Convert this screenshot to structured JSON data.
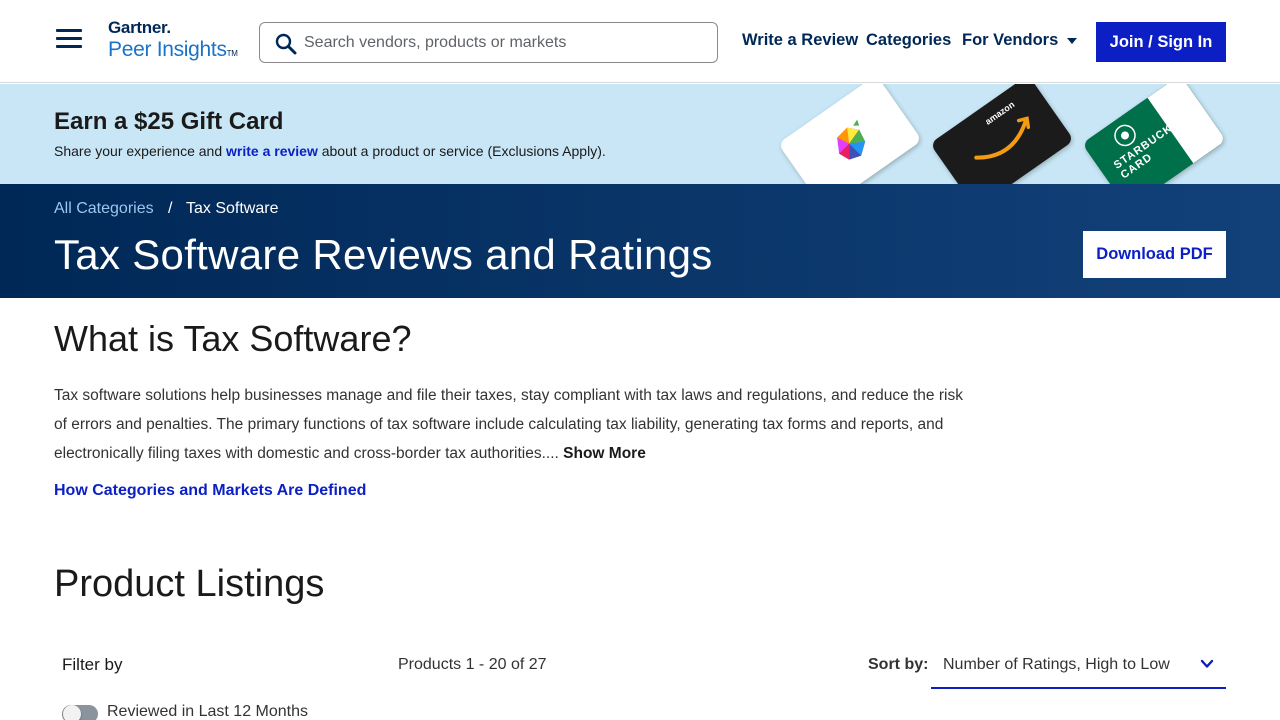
{
  "header": {
    "logo_top": "Gartner.",
    "logo_bottom": "Peer Insights",
    "logo_tm": "TM",
    "search_placeholder": "Search vendors, products or markets",
    "nav_write": "Write a Review",
    "nav_categories": "Categories",
    "nav_vendors": "For Vendors",
    "join_label": "Join / Sign In",
    "icons": [
      "menu-icon",
      "search-icon",
      "caret-down-icon"
    ]
  },
  "promo": {
    "title": "Earn a $25 Gift Card",
    "text_before": "Share your experience and ",
    "link": "write a review",
    "text_after": " about a product or service (Exclusions Apply).",
    "cards": [
      "apple",
      "amazon",
      "STARBUCKS CARD"
    ]
  },
  "category": {
    "crumb_all": "All Categories",
    "crumb_sep": "/",
    "crumb_current": "Tax Software",
    "title": "Tax Software Reviews and Ratings",
    "pdf_label": "Download PDF"
  },
  "about": {
    "title": "What is Tax Software?",
    "description": "Tax software solutions help businesses manage and file their taxes, stay compliant with tax laws and regulations, and reduce the risk of errors and penalties. The primary functions of tax software include calculating tax liability, generating tax forms and reports, and electronically filing taxes with domestic and cross-border tax authorities....",
    "show_more": "Show More",
    "how_link": "How Categories and Markets Are Defined"
  },
  "listings": {
    "title": "Product Listings",
    "filter_label": "Filter by",
    "count": "Products 1 - 20 of 27",
    "sort_label": "Sort by:",
    "sort_value": "Number of Ratings, High to Low",
    "toggle_label": "Reviewed in Last 12 Months",
    "toggle_on": false
  },
  "colors": {
    "navy": "#002856",
    "accent_blue": "#0b1fc4",
    "promo_bg": "#c8e6f5"
  }
}
